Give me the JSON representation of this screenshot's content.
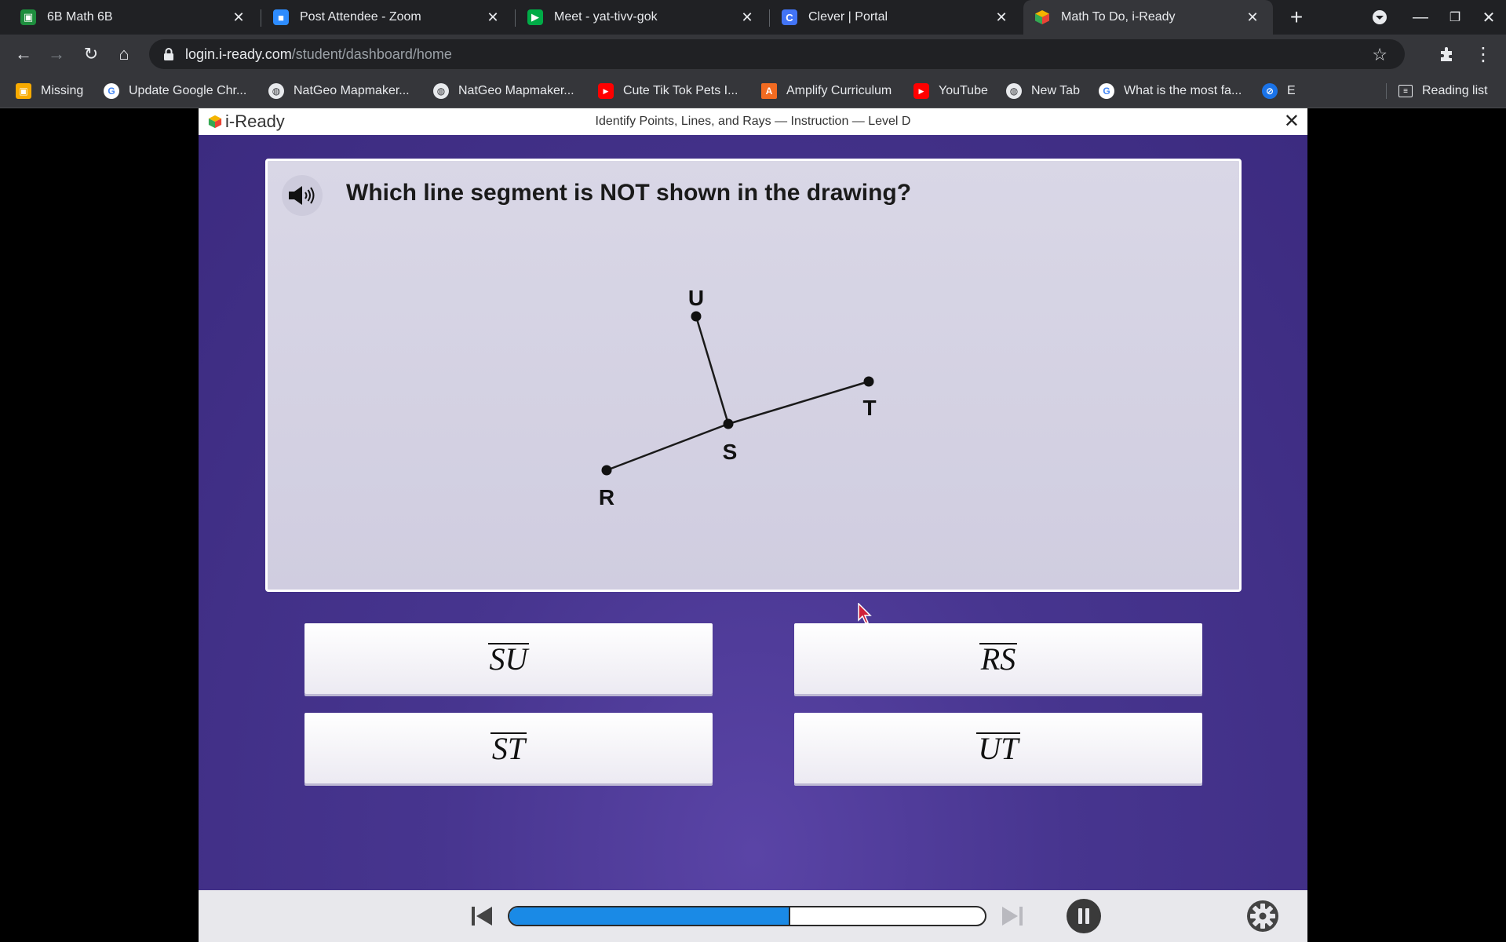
{
  "browser": {
    "tabs": [
      {
        "title": "6B Math 6B",
        "icon_color": "#1e8e3e",
        "icon_glyph": "▣"
      },
      {
        "title": "Post Attendee - Zoom",
        "icon_color": "#2d8cff",
        "icon_glyph": "▶"
      },
      {
        "title": "Meet - yat-tivv-gok",
        "icon_color": "#00ac47",
        "icon_glyph": "▶"
      },
      {
        "title": "Clever | Portal",
        "icon_color": "#4274f6",
        "icon_glyph": "C"
      },
      {
        "title": "Math To Do, i-Ready",
        "icon_color": "#f4b400",
        "icon_glyph": "◆"
      }
    ],
    "url_host": "login.i-ready.com",
    "url_path": "/student/dashboard/home",
    "bookmarks": [
      {
        "label": "Missing",
        "icon_color": "#f9ab00",
        "icon_glyph": "▣"
      },
      {
        "label": "Update Google Chr...",
        "icon_color": "#4285f4",
        "icon_glyph": "G"
      },
      {
        "label": "NatGeo Mapmaker...",
        "icon_color": "#9aa0a6",
        "icon_glyph": "◍"
      },
      {
        "label": "NatGeo Mapmaker...",
        "icon_color": "#9aa0a6",
        "icon_glyph": "◍"
      },
      {
        "label": "Cute Tik Tok Pets I...",
        "icon_color": "#ff0000",
        "icon_glyph": "▶"
      },
      {
        "label": "Amplify Curriculum",
        "icon_color": "#f26b21",
        "icon_glyph": "A"
      },
      {
        "label": "YouTube",
        "icon_color": "#ff0000",
        "icon_glyph": "▶"
      },
      {
        "label": "New Tab",
        "icon_color": "#9aa0a6",
        "icon_glyph": "◍"
      },
      {
        "label": "What is the most fa...",
        "icon_color": "#4285f4",
        "icon_glyph": "G"
      },
      {
        "label": "E",
        "icon_color": "#1a73e8",
        "icon_glyph": "⊘"
      }
    ],
    "reading_list": "Reading list"
  },
  "iready": {
    "logo": "i-Ready",
    "lesson_title": "Identify Points, Lines, and Rays — Instruction — Level D",
    "question": "Which line segment is NOT shown in the drawing?",
    "points": [
      "U",
      "T",
      "S",
      "R"
    ],
    "answers": [
      "SU",
      "RS",
      "ST",
      "UT"
    ],
    "progress_fraction": 0.59
  }
}
